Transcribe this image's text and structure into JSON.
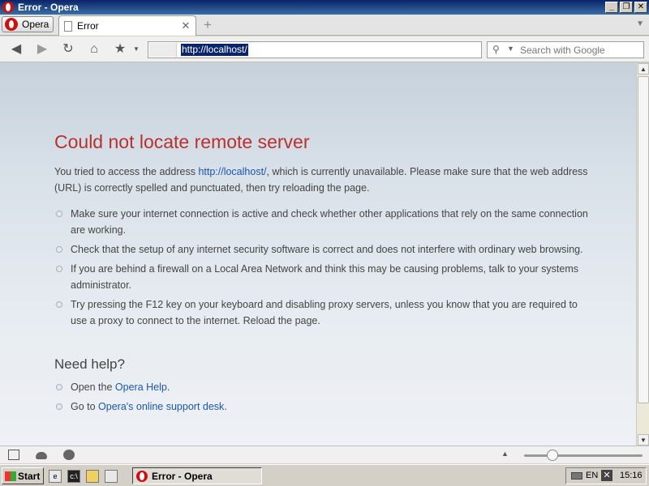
{
  "window": {
    "title": "Error - Opera"
  },
  "tabs": {
    "menu_label": "Opera",
    "active_tab": "Error"
  },
  "toolbar": {
    "address": "http://localhost/",
    "search_placeholder": "Search with Google"
  },
  "page": {
    "title": "Could not locate remote server",
    "intro_before": "You tried to access the address ",
    "intro_link": "http://localhost/",
    "intro_after": ", which is currently unavailable. Please make sure that the web address (URL) is correctly spelled and punctuated, then try reloading the page.",
    "tips": [
      "Make sure your internet connection is active and check whether other applications that rely on the same connection are working.",
      "Check that the setup of any internet security software is correct and does not interfere with ordinary web browsing.",
      "If you are behind a firewall on a Local Area Network and think this may be causing problems, talk to your systems administrator.",
      "Try pressing the F12 key on your keyboard and disabling proxy servers, unless you know that you are required to use a proxy to connect to the internet. Reload the page."
    ],
    "help_title": "Need help?",
    "help1_before": "Open the ",
    "help1_link": "Opera Help",
    "help1_after": ".",
    "help2_before": "Go to ",
    "help2_link": "Opera's online support desk",
    "help2_after": "."
  },
  "statusbar": {
    "zoom_level": 0.24
  },
  "taskbar": {
    "start_label": "Start",
    "task_label": "Error - Opera",
    "language": "EN",
    "clock": "15:16"
  },
  "icons": [
    "opera-logo-icon",
    "page-icon",
    "back-icon",
    "forward-icon",
    "reload-icon",
    "home-icon",
    "bookmark-star-icon",
    "search-icon",
    "panel-icon",
    "cloud-icon",
    "turbo-icon",
    "windows-logo-icon",
    "network-icon"
  ]
}
